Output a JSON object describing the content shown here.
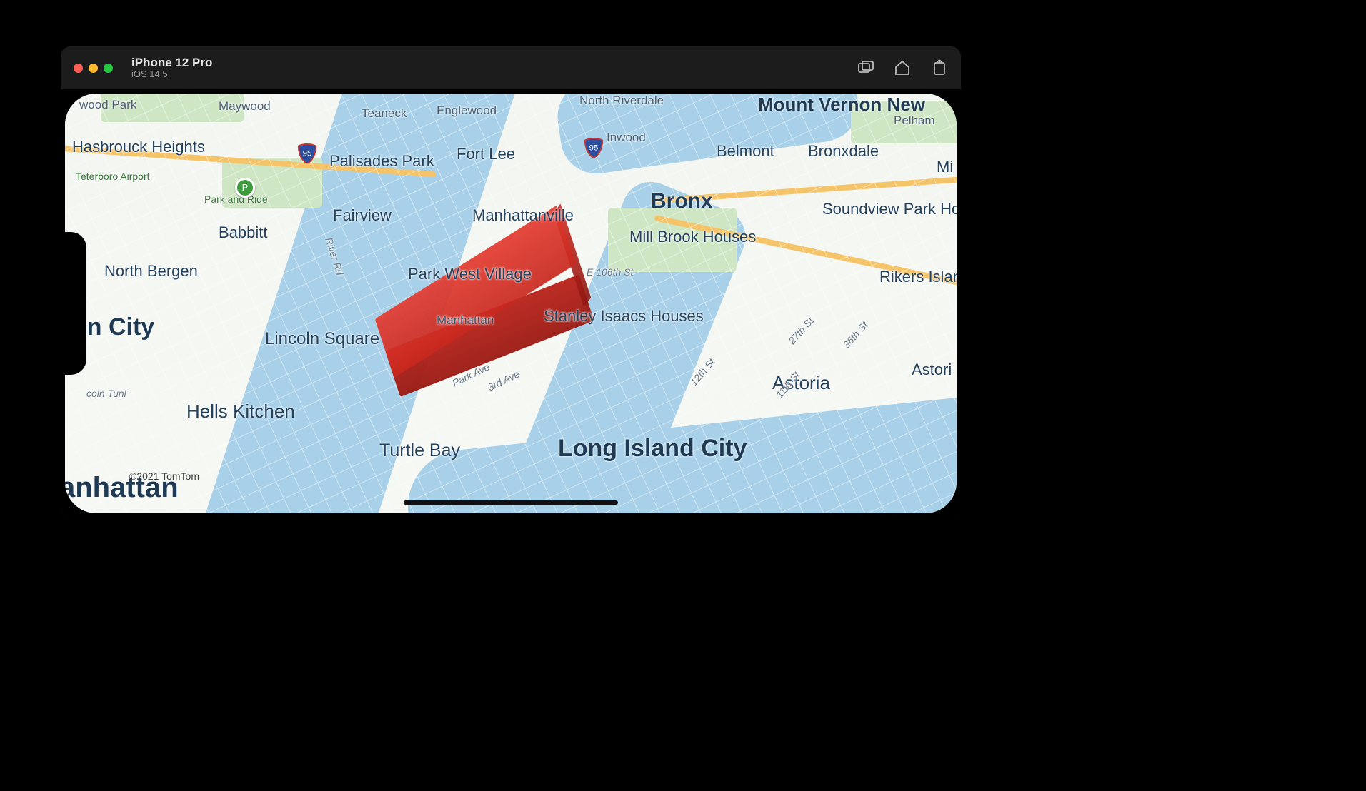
{
  "window": {
    "device_name": "iPhone 12 Pro",
    "os_version": "iOS 14.5"
  },
  "attribution": "©2021 TomTom",
  "overlay": {
    "name": "3D extruded polygon",
    "color": "#d62b20"
  },
  "labels": {
    "wood_park": "wood Park",
    "maywood": "Maywood",
    "teaneck": "Teaneck",
    "englewood": "Englewood",
    "north_riverdale": "North Riverdale",
    "mount_vernon": "Mount Vernon New",
    "pelham": "Pelham",
    "hasbrouck": "Hasbrouck Heights",
    "palisades_park": "Palisades Park",
    "fort_lee": "Fort Lee",
    "inwood": "Inwood",
    "belmont": "Belmont",
    "bronxdale": "Bronxdale",
    "mi_frag": "Mi",
    "teterboro": "Teterboro Airport",
    "park_and_ride": "Park and Ride",
    "fairview": "Fairview",
    "manhattanville": "Manhattanville",
    "bronx": "Bronx",
    "soundview": "Soundview Park Homes",
    "babbitt": "Babbitt",
    "mill_brook": "Mill Brook Houses",
    "rikers": "Rikers Islan",
    "north_bergen": "North Bergen",
    "park_west": "Park West Village",
    "e106": "E 106th St",
    "on_city": "on City",
    "lincoln_square": "Lincoln Square",
    "manhattan_small": "Manhattan",
    "stanley_isaacs": "Stanley Isaacs Houses",
    "astoria": "Astoria",
    "astoria_frag": "Astori",
    "hells_kitchen": "Hells Kitchen",
    "coin_tunl": "coln Tunl",
    "turtle_bay": "Turtle Bay",
    "long_island_city": "Long Island City",
    "anhattan": "anhattan",
    "park_ave": "Park Ave",
    "third_ave": "3rd Ave",
    "river_rd": "River Rd",
    "twelfth": "12th St",
    "twentyseventh": "27th St",
    "eleventh": "11th St",
    "thirtysixth": "36th St",
    "shield_95": "95"
  }
}
